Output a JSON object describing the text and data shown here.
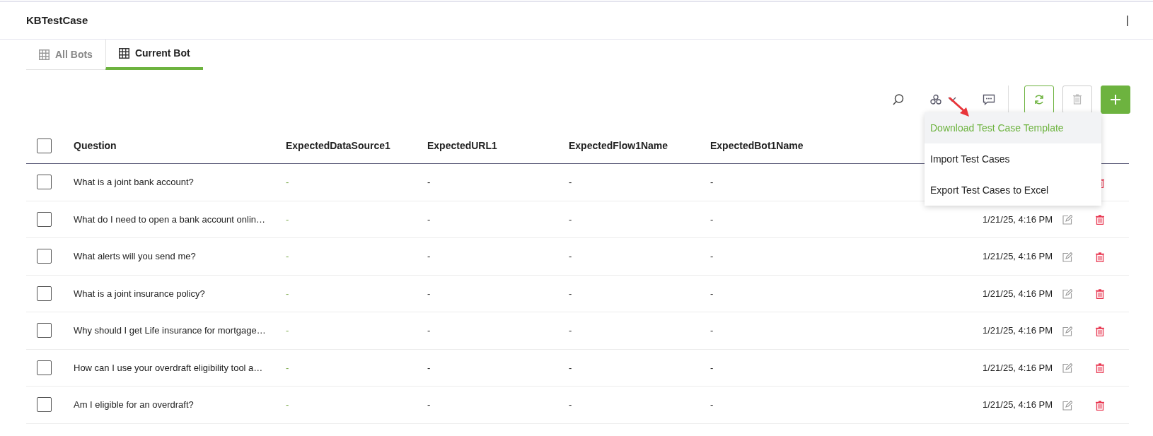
{
  "header": {
    "title": "KBTestCase",
    "separator": "|"
  },
  "tabs": [
    {
      "label": "All Bots",
      "selected": false
    },
    {
      "label": "Current Bot",
      "selected": true
    }
  ],
  "dropdown": {
    "items": [
      {
        "label": "Download Test Case Template",
        "selected": true
      },
      {
        "label": "Import Test Cases",
        "selected": false
      },
      {
        "label": "Export Test Cases to Excel",
        "selected": false
      }
    ]
  },
  "table": {
    "select_all_checked": false,
    "columns": [
      "Question",
      "ExpectedDataSource1",
      "ExpectedURL1",
      "ExpectedFlow1Name",
      "ExpectedBot1Name"
    ],
    "rows": [
      {
        "checked": false,
        "question": "What is a joint bank account?",
        "data_source": "-",
        "url": "-",
        "flow": "-",
        "bot": "-"
      },
      {
        "checked": false,
        "question": "What do I need to open a bank account onlin…",
        "data_source": "-",
        "url": "-",
        "flow": "-",
        "bot": "-",
        "date": "1/21/25, 4:16 PM"
      },
      {
        "checked": false,
        "question": "What alerts will you send me?",
        "data_source": "-",
        "url": "-",
        "flow": "-",
        "bot": "-",
        "date": "1/21/25, 4:16 PM"
      },
      {
        "checked": false,
        "question": "What is a joint insurance policy?",
        "data_source": "-",
        "url": "-",
        "flow": "-",
        "bot": "-",
        "date": "1/21/25, 4:16 PM"
      },
      {
        "checked": false,
        "question": "Why should I get Life insurance for mortgage…",
        "data_source": "-",
        "url": "-",
        "flow": "-",
        "bot": "-",
        "date": "1/21/25, 4:16 PM"
      },
      {
        "checked": false,
        "question": "How can I use your overdraft eligibility tool a…",
        "data_source": "-",
        "url": "-",
        "flow": "-",
        "bot": "-",
        "date": "1/21/25, 4:16 PM"
      },
      {
        "checked": false,
        "question": "Am I eligible for an overdraft?",
        "data_source": "-",
        "url": "-",
        "flow": "-",
        "bot": "-",
        "date": "1/21/25, 4:16 PM"
      }
    ]
  }
}
